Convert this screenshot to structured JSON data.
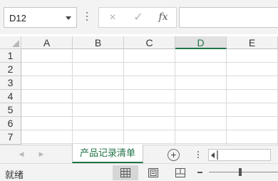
{
  "formula_bar": {
    "name_box_value": "D12",
    "cancel_icon": "×",
    "enter_icon": "✓",
    "fx_label": "fx",
    "formula_value": ""
  },
  "grid": {
    "columns": [
      "A",
      "B",
      "C",
      "D",
      "E"
    ],
    "selected_column": "D",
    "rows": [
      "1",
      "2",
      "3",
      "4",
      "5",
      "6",
      "7"
    ],
    "selected_cell": "D12"
  },
  "sheets": {
    "prev_arrow": "◀",
    "next_arrow": "▶",
    "active_tab": "产品记录清单",
    "add_icon": "+"
  },
  "status_bar": {
    "ready_text": "就绪"
  },
  "colors": {
    "accent": "#217346",
    "chrome_bg": "#f3f3f3",
    "gridline": "#dadada"
  }
}
